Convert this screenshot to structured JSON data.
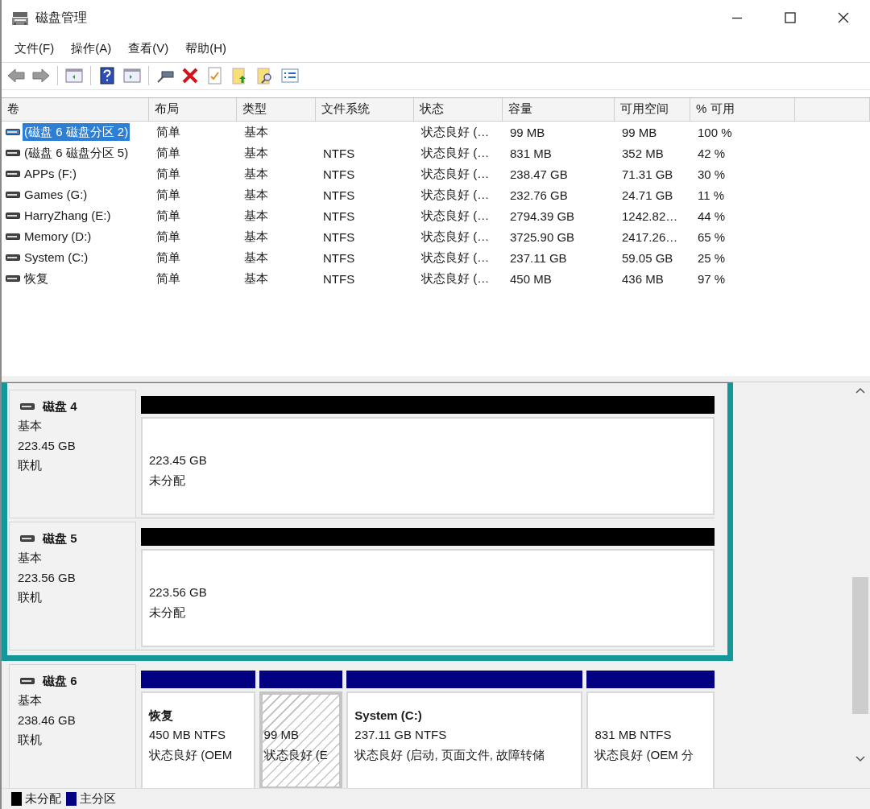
{
  "window": {
    "title": "磁盘管理"
  },
  "menu": [
    "文件(F)",
    "操作(A)",
    "查看(V)",
    "帮助(H)"
  ],
  "volume_table": {
    "columns": [
      "卷",
      "布局",
      "类型",
      "文件系统",
      "状态",
      "容量",
      "可用空间",
      "% 可用"
    ],
    "rows": [
      {
        "selected": true,
        "volume": "(磁盘 6 磁盘分区 2)",
        "layout": "简单",
        "type": "基本",
        "status": "状态良好 (…",
        "capacity": "99 MB",
        "free": "99 MB",
        "percent_free": "100 %"
      },
      {
        "selected": false,
        "volume": "(磁盘 6 磁盘分区 5)",
        "layout": "简单",
        "type": "基本",
        "file_system": "NTFS",
        "status": "状态良好 (…",
        "capacity": "831 MB",
        "free": "352 MB",
        "percent_free": "42 %"
      },
      {
        "selected": false,
        "volume": "APPs (F:)",
        "layout": "简单",
        "type": "基本",
        "file_system": "NTFS",
        "status": "状态良好 (…",
        "capacity": "238.47 GB",
        "free": "71.31 GB",
        "percent_free": "30 %"
      },
      {
        "selected": false,
        "volume": "Games (G:)",
        "layout": "简单",
        "type": "基本",
        "file_system": "NTFS",
        "status": "状态良好 (…",
        "capacity": "232.76 GB",
        "free": "24.71 GB",
        "percent_free": "11 %"
      },
      {
        "selected": false,
        "volume": "HarryZhang (E:)",
        "layout": "简单",
        "type": "基本",
        "file_system": "NTFS",
        "status": "状态良好 (…",
        "capacity": "2794.39 GB",
        "free": "1242.82…",
        "percent_free": "44 %"
      },
      {
        "selected": false,
        "volume": "Memory (D:)",
        "layout": "简单",
        "type": "基本",
        "file_system": "NTFS",
        "status": "状态良好 (…",
        "capacity": "3725.90 GB",
        "free": "2417.26…",
        "percent_free": "65 %"
      },
      {
        "selected": false,
        "volume": "System (C:)",
        "layout": "简单",
        "type": "基本",
        "file_system": "NTFS",
        "status": "状态良好 (…",
        "capacity": "237.11 GB",
        "free": "59.05 GB",
        "percent_free": "25 %"
      },
      {
        "selected": false,
        "volume": "恢复",
        "layout": "简单",
        "type": "基本",
        "file_system": "NTFS",
        "status": "状态良好 (…",
        "capacity": "450 MB",
        "free": "436 MB",
        "percent_free": "97 %"
      }
    ]
  },
  "disks": [
    {
      "name": "磁盘 4",
      "type": "基本",
      "size": "223.45 GB",
      "status": "联机",
      "highlighted": true,
      "partitions": [
        {
          "kind": "unallocated",
          "selected": false,
          "lines": [
            "223.45 GB",
            "未分配"
          ]
        }
      ]
    },
    {
      "name": "磁盘 5",
      "type": "基本",
      "size": "223.56 GB",
      "status": "联机",
      "highlighted": true,
      "partitions": [
        {
          "kind": "unallocated",
          "selected": false,
          "lines": [
            "223.56 GB",
            "未分配"
          ]
        }
      ]
    },
    {
      "name": "磁盘 6",
      "type": "基本",
      "size": "238.46 GB",
      "status": "联机",
      "highlighted": false,
      "partitions": [
        {
          "kind": "primary",
          "selected": false,
          "title": "恢复",
          "lines": [
            "450 MB NTFS",
            "状态良好 (OEM"
          ]
        },
        {
          "kind": "primary",
          "selected": true,
          "lines": [
            "99 MB",
            "状态良好 (E"
          ]
        },
        {
          "kind": "primary",
          "selected": false,
          "title": "System  (C:)",
          "lines": [
            "237.11 GB NTFS",
            "状态良好 (启动, 页面文件, 故障转储"
          ]
        },
        {
          "kind": "primary",
          "selected": false,
          "lines": [
            "831 MB NTFS",
            "状态良好 (OEM 分"
          ]
        }
      ]
    }
  ],
  "legend": [
    {
      "label": "未分配",
      "color": "#000000"
    },
    {
      "label": "主分区",
      "color": "#000080"
    }
  ]
}
